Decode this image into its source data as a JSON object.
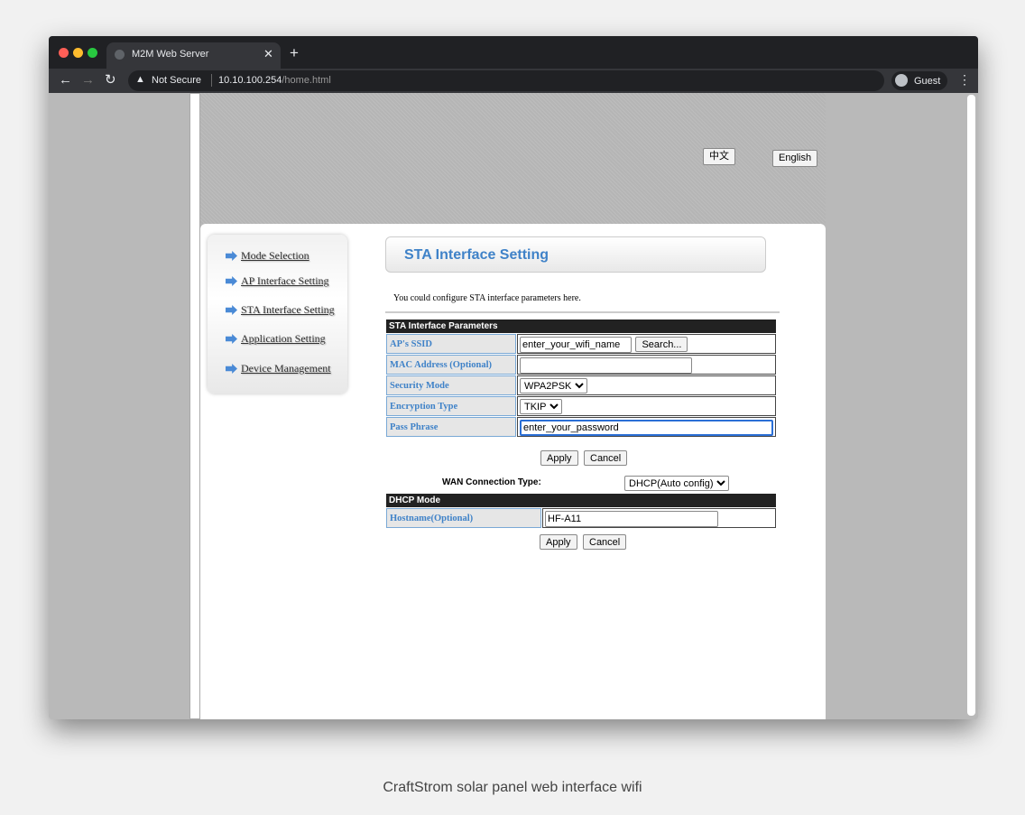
{
  "browser": {
    "tab_title": "M2M Web Server",
    "security": "Not Secure",
    "url_host": "10.10.100.254",
    "url_path": "/home.html",
    "profile": "Guest"
  },
  "lang": {
    "chinese": "中文",
    "english": "English"
  },
  "nav": {
    "items": [
      {
        "label": "Mode Selection"
      },
      {
        "label": "AP Interface Setting"
      },
      {
        "label": "STA Interface Setting"
      },
      {
        "label": "Application Setting"
      },
      {
        "label": "Device Management"
      }
    ]
  },
  "main": {
    "title": "STA Interface Setting",
    "description": "You could configure STA interface parameters here.",
    "sta": {
      "header": "STA Interface Parameters",
      "ssid_label": "AP's SSID",
      "ssid_value": "enter_your_wifi_name",
      "search_label": "Search...",
      "mac_label": "MAC Address (Optional)",
      "mac_value": "",
      "security_label": "Security Mode",
      "security_value": "WPA2PSK",
      "encryption_label": "Encryption Type",
      "encryption_value": "TKIP",
      "pass_label": "Pass Phrase",
      "pass_value": "enter_your_password",
      "apply": "Apply",
      "cancel": "Cancel"
    },
    "wan": {
      "label": "WAN Connection Type:",
      "value": "DHCP(Auto config)"
    },
    "dhcp": {
      "header": "DHCP Mode",
      "hostname_label": "Hostname(Optional)",
      "hostname_value": "HF-A11",
      "apply": "Apply",
      "cancel": "Cancel"
    }
  },
  "caption": "CraftStrom solar panel web interface wifi"
}
